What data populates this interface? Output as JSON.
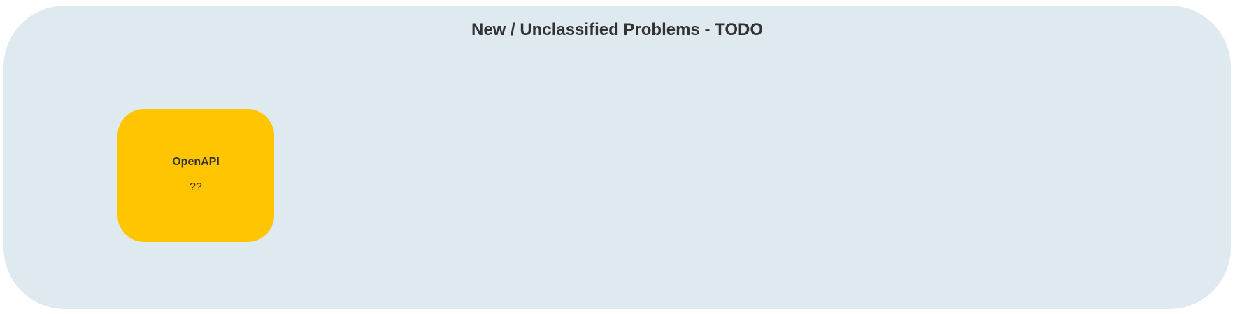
{
  "group": {
    "title": "New / Unclassified Problems - TODO",
    "background_color": "#deeaef"
  },
  "nodes": [
    {
      "title": "OpenAPI",
      "body": "??",
      "color": "#ffc500"
    }
  ]
}
